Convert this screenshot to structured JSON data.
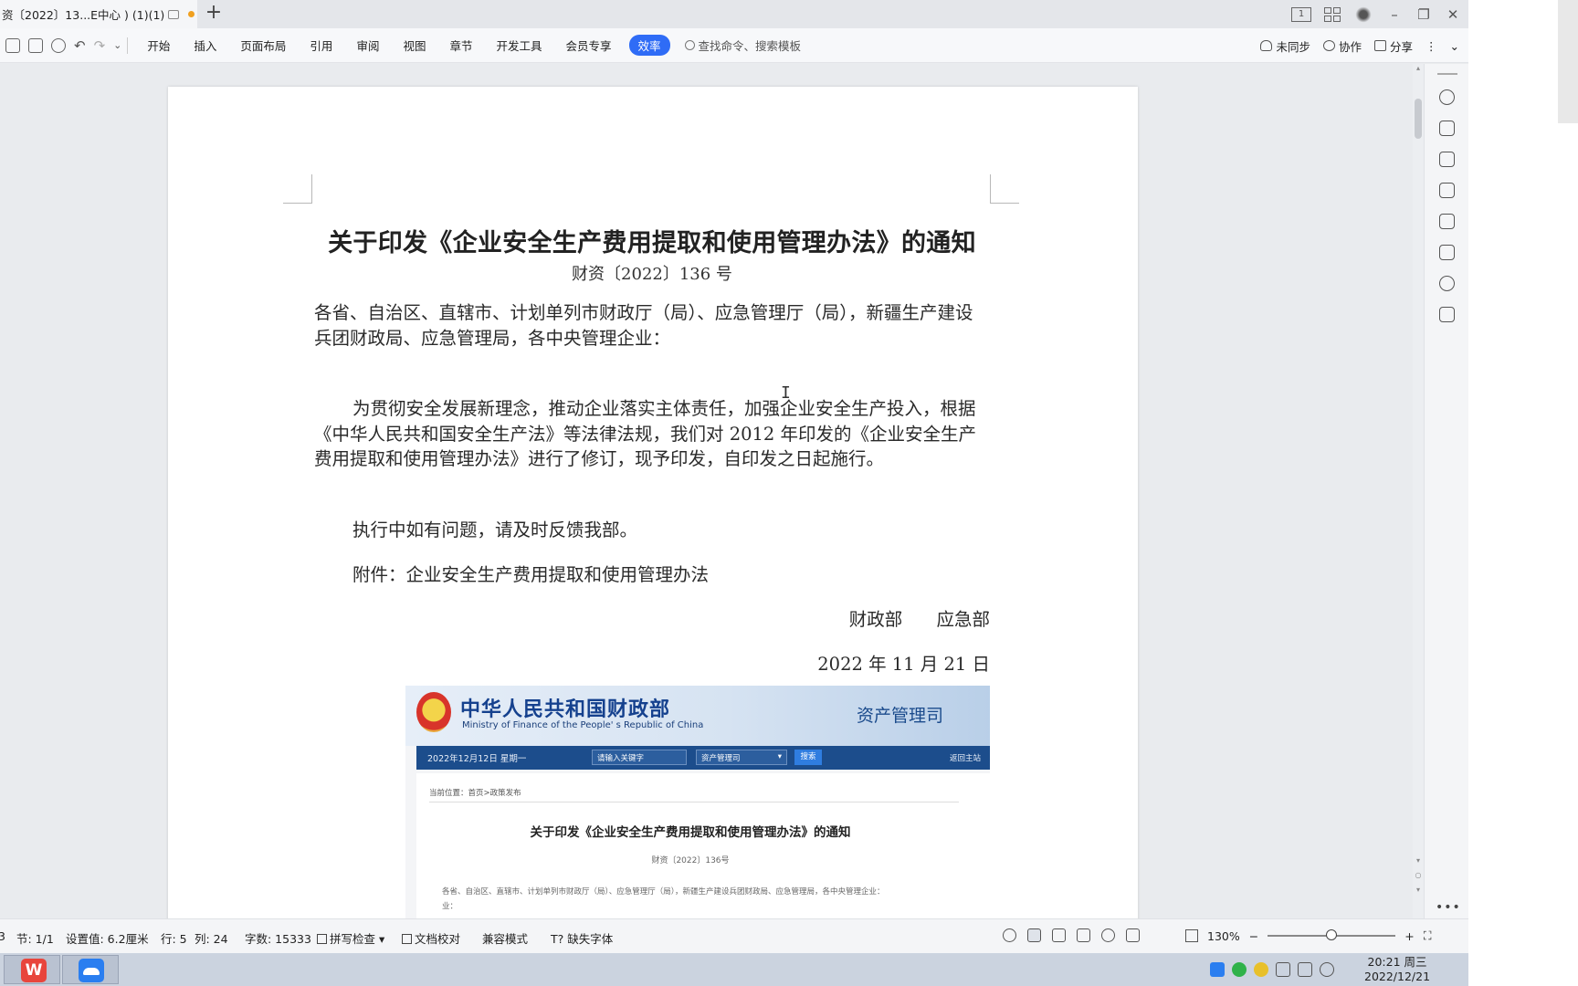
{
  "tab": {
    "title": "资〔2022〕13...E中心 ) (1)(1)"
  },
  "toolbar": {
    "menu": [
      "开始",
      "插入",
      "页面布局",
      "引用",
      "审阅",
      "视图",
      "章节",
      "开发工具",
      "会员专享",
      "效率"
    ],
    "active_menu": "效率",
    "search_placeholder": "查找命令、搜索模板",
    "sync_label": "未同步",
    "collab_label": "协作",
    "share_label": "分享"
  },
  "document": {
    "title": "关于印发《企业安全生产费用提取和使用管理办法》的通知",
    "doc_number": "财资〔2022〕136 号",
    "addressee": "各省、自治区、直辖市、计划单列市财政厅（局）、应急管理厅（局），新疆生产建设兵团财政局、应急管理局，各中央管理企业：",
    "paragraph1": "为贯彻安全发展新理念，推动企业落实主体责任，加强企业安全生产投入，根据《中华人民共和国安全生产法》等法律法规，我们对 2012 年印发的《企业安全生产费用提取和使用管理办法》进行了修订，现予印发，自印发之日起施行。",
    "paragraph2": "执行中如有问题，请及时反馈我部。",
    "attachment": "附件：企业安全生产费用提取和使用管理办法",
    "signers": "财政部      应急部",
    "date": "2022 年 11 月 21 日"
  },
  "embedded": {
    "site_name_cn": "中华人民共和国财政部",
    "site_name_en": "Ministry of Finance of the People' s Republic of China",
    "department": "资产管理司",
    "nav_date": "2022年12月12日 星期一",
    "search_placeholder": "请输入关键字",
    "select_value": "资产管理司",
    "search_button": "搜索",
    "home_link": "返回主站",
    "breadcrumb": "当前位置：首页>政策发布",
    "title": "关于印发《企业安全生产费用提取和使用管理办法》的通知",
    "doc_number": "财资〔2022〕136号",
    "first_line": "各省、自治区、直辖市、计划单列市财政厅（局）、应急管理厅（局），新疆生产建设兵团财政局、应急管理局，各中央管理企业：",
    "second_line": "业："
  },
  "statusbar": {
    "page": "3",
    "section": "节: 1/1",
    "setting": "设置值: 6.2厘米",
    "row": "行: 5",
    "col": "列: 24",
    "word_count": "字数: 15333",
    "spellcheck": "拼写检查",
    "proofread": "文档校对",
    "compat": "兼容模式",
    "missing_font": "缺失字体",
    "zoom": "130%",
    "zoom_level_fraction": 0.5
  },
  "taskbar": {
    "clock_time": "20:21 周三",
    "clock_date": "2022/12/21",
    "wps_glyph": "W"
  },
  "colors": {
    "accent": "#2f6cf6",
    "modified_dot": "#f0a020",
    "mof_blue": "#1c4d8c"
  },
  "icons": [
    "print-icon",
    "preview-icon",
    "undo-icon",
    "redo-icon",
    "search-icon",
    "cloud-icon",
    "user-icon",
    "share-icon",
    "help-icon",
    "pen-icon",
    "cursor-icon",
    "sliders-icon",
    "image-icon",
    "location-icon",
    "book-icon"
  ]
}
